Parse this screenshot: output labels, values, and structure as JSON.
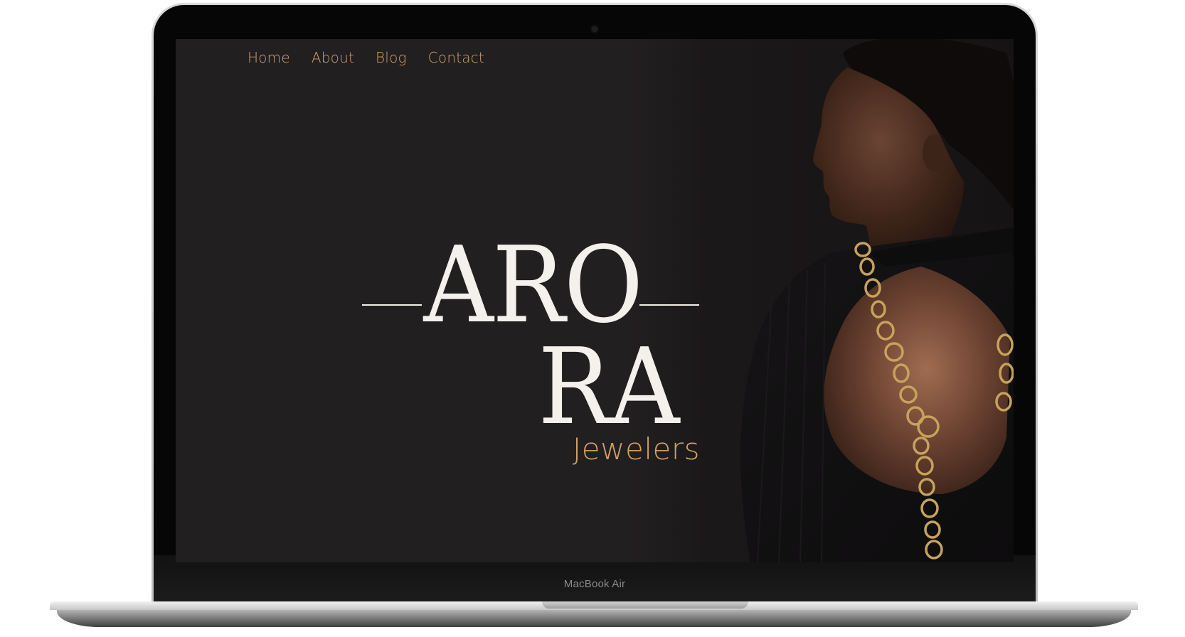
{
  "device": {
    "model_label": "MacBook Air"
  },
  "nav": {
    "items": [
      {
        "label": "Home"
      },
      {
        "label": "About"
      },
      {
        "label": "Blog"
      },
      {
        "label": "Contact"
      }
    ]
  },
  "brand": {
    "line1": "ARO",
    "line2": "RA",
    "tagline": "Jewelers"
  },
  "hero_image": {
    "description_icon": "model-photo"
  },
  "colors": {
    "background": "#221f21",
    "accent_gold": "#d2a067",
    "logo_white": "#f4f1ec"
  }
}
